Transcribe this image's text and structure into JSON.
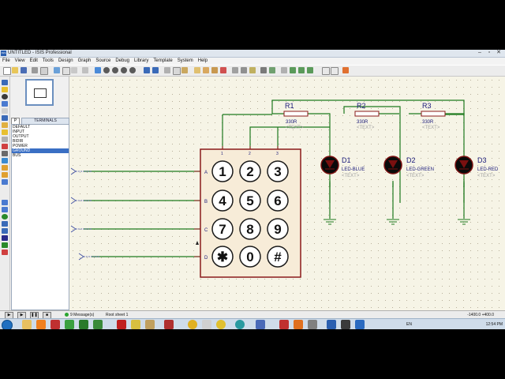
{
  "window": {
    "title": "UNTITLED - ISIS Professional",
    "app_icon": "ISIS"
  },
  "menu": [
    "File",
    "View",
    "Edit",
    "Tools",
    "Design",
    "Graph",
    "Source",
    "Debug",
    "Library",
    "Template",
    "System",
    "Help"
  ],
  "panel": {
    "p_label": "P",
    "header": "TERMINALS",
    "items": [
      "DEFAULT",
      "INPUT",
      "OUTPUT",
      "BIDIR",
      "POWER",
      "GROUND",
      "BUS"
    ],
    "selected": "GROUND"
  },
  "schematic": {
    "keypad": {
      "keys": [
        "1",
        "2",
        "3",
        "4",
        "5",
        "6",
        "7",
        "8",
        "9",
        "✱",
        "0",
        "#"
      ],
      "rows": [
        "A",
        "B",
        "C",
        "D"
      ],
      "cols": [
        "1",
        "2",
        "3"
      ]
    },
    "resistors": [
      {
        "ref": "R1",
        "value": "330R",
        "text": "<TEXT>"
      },
      {
        "ref": "R2",
        "value": "330R",
        "text": "<TEXT>"
      },
      {
        "ref": "R3",
        "value": "330R",
        "text": "<TEXT>"
      }
    ],
    "leds": [
      {
        "ref": "D1",
        "value": "LED-BLUE",
        "text": "<TEXT>"
      },
      {
        "ref": "D2",
        "value": "LED-GREEN",
        "text": "<TEXT>"
      },
      {
        "ref": "D3",
        "value": "LED-RED",
        "text": "<TEXT>"
      }
    ]
  },
  "status": {
    "messages": "9 Message(s)",
    "sheet": "Root sheet 1",
    "coords": "-1400.0   +400.0"
  },
  "taskbar": {
    "lang": "EN",
    "time": "12:54 PM"
  }
}
